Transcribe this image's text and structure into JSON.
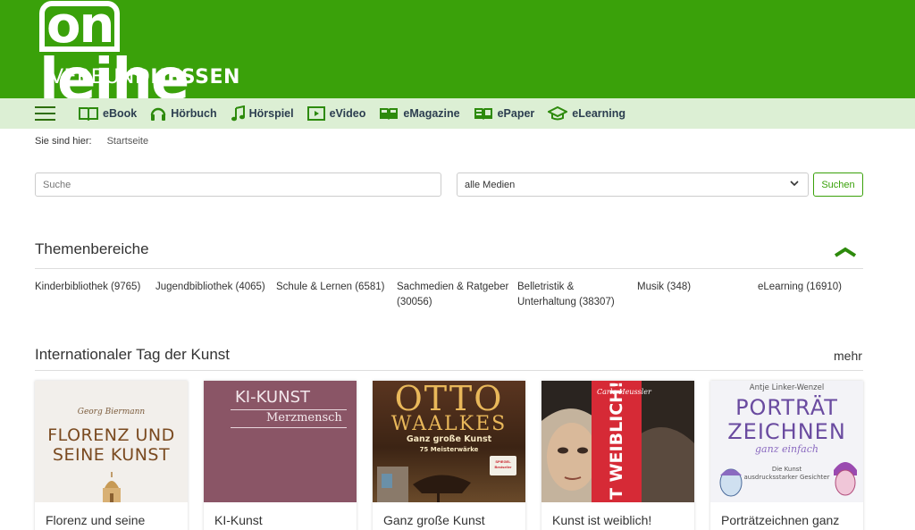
{
  "logo": {
    "brand_on": "on",
    "brand_rest": "leihe",
    "sub_left": "VERBUND",
    "sub_right": "HESSEN"
  },
  "nav": {
    "items": [
      {
        "label": "eBook",
        "icon": "book-icon"
      },
      {
        "label": "Hörbuch",
        "icon": "headphones-icon"
      },
      {
        "label": "Hörspiel",
        "icon": "music-note-icon"
      },
      {
        "label": "eVideo",
        "icon": "play-icon"
      },
      {
        "label": "eMagazine",
        "icon": "magazine-icon"
      },
      {
        "label": "ePaper",
        "icon": "newspaper-icon"
      },
      {
        "label": "eLearning",
        "icon": "graduation-cap-icon"
      }
    ]
  },
  "breadcrumb": {
    "prefix": "Sie sind hier:",
    "current": "Startseite"
  },
  "search": {
    "placeholder": "Suche",
    "media_selected": "alle Medien",
    "button": "Suchen"
  },
  "themes": {
    "title": "Themenbereiche",
    "items": [
      {
        "label": "Kinderbibliothek (9765)"
      },
      {
        "label": "Jugendbibliothek (4065)"
      },
      {
        "label": "Schule & Lernen (6581)"
      },
      {
        "label": "Sachmedien & Ratgeber (30056)"
      },
      {
        "label": "Belletristik & Unterhaltung (38307)"
      },
      {
        "label": "Musik (348)"
      },
      {
        "label": "eLearning (16910)"
      }
    ]
  },
  "feature": {
    "title": "Internationaler Tag der Kunst",
    "more": "mehr",
    "cards": [
      {
        "title": "Florenz und seine",
        "cover_author": "Georg Biermann",
        "cover_title_1": "FLORENZ UND",
        "cover_title_2": "SEINE KUNST"
      },
      {
        "title": "KI-Kunst",
        "cover_title_1": "KI-KUNST",
        "cover_title_2": "Merzmensch"
      },
      {
        "title": "Ganz große Kunst",
        "cover_title_1": "OTTO",
        "cover_title_2": "WAALKES",
        "cover_title_3": "Ganz große Kunst",
        "cover_title_4": "75 Meisterwärke",
        "cover_badge": "SPIEGEL Bestseller"
      },
      {
        "title": "Kunst ist weiblich!",
        "cover_author": "Carla Heussler",
        "cover_title_1": "T WEIBLICH!"
      },
      {
        "title": "Porträtzeichnen ganz",
        "cover_author": "Antje Linker-Wenzel",
        "cover_title_1": "PORTRÄT",
        "cover_title_2": "ZEICHNEN",
        "cover_title_3": "ganz einfach",
        "cover_title_4": "Die Kunst",
        "cover_title_5": "ausdrucksstarker Gesichter"
      }
    ]
  },
  "colors": {
    "brand_green": "#3aa10a",
    "nav_bg": "#dcefd4",
    "icon_green": "#2d8a0c"
  }
}
